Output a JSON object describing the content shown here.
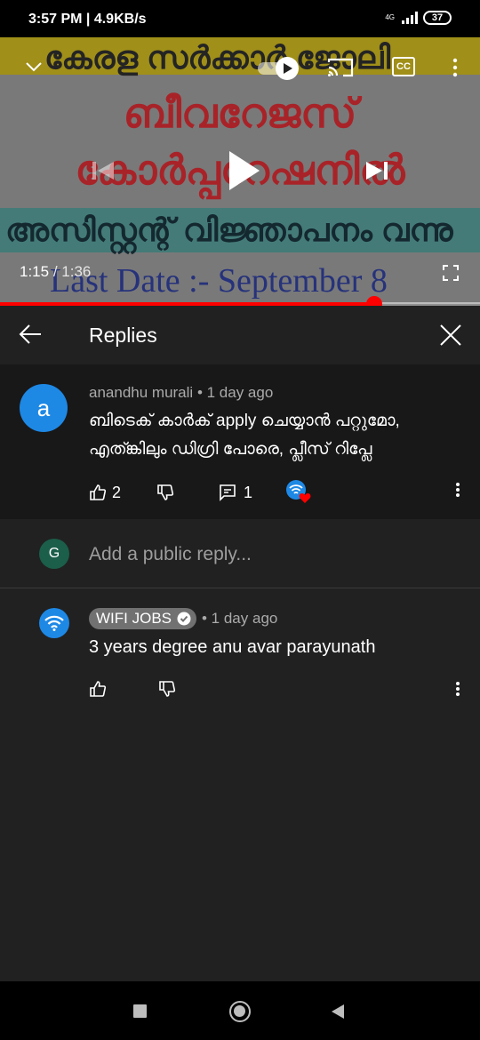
{
  "status_bar": {
    "time": "3:57 PM | 4.9KB/s",
    "network": "4G",
    "battery": "37"
  },
  "video": {
    "banner_line1": "കേരള സർക്കാർ ജോലി",
    "banner_line2": "ബീവറേജസ്",
    "banner_line3": "കോർപ്പറേഷനിൽ",
    "banner_line4": "അസിസ്റ്റന്റ് വിജ്ഞാപനം വന്നു",
    "banner_line5": "Last Date :- September 8",
    "current_time": "1:15",
    "duration": "/ 1:36",
    "progress": 0.78,
    "cc_label": "CC"
  },
  "replies_panel": {
    "title": "Replies"
  },
  "parent_comment": {
    "avatar_letter": "a",
    "author": "anandhu murali",
    "time_ago": "• 1 day ago",
    "text": "ബിടെക് കാർക് apply ചെയ്യാൻ പറ്റുമോ, എത്ങ്കിലും ഡിഗ്രി പോരെ, പ്ലീസ് റിപ്ലേ",
    "likes": "2",
    "replies": "1"
  },
  "add_reply": {
    "avatar_letter": "G",
    "placeholder": "Add a public reply..."
  },
  "reply": {
    "author": "WIFI JOBS",
    "time_ago": "• 1 day ago",
    "text": "3 years degree anu avar parayunath"
  },
  "colors": {
    "accent_red": "#ff0000",
    "avatar_blue": "#1e88e5",
    "avatar_green": "#1b5e4a"
  }
}
